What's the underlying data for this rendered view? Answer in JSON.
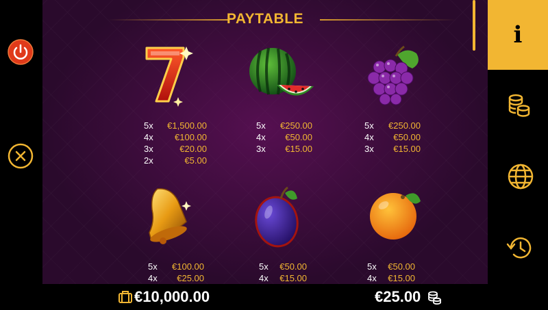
{
  "title": "PAYTABLE",
  "colors": {
    "accent": "#f2b632",
    "background": "#2a0a2c",
    "panel": "#000000"
  },
  "symbols": [
    {
      "name": "seven",
      "pays": [
        {
          "mult": "5x",
          "val": "€1,500.00"
        },
        {
          "mult": "4x",
          "val": "€100.00"
        },
        {
          "mult": "3x",
          "val": "€20.00"
        },
        {
          "mult": "2x",
          "val": "€5.00"
        }
      ]
    },
    {
      "name": "watermelon",
      "pays": [
        {
          "mult": "5x",
          "val": "€250.00"
        },
        {
          "mult": "4x",
          "val": "€50.00"
        },
        {
          "mult": "3x",
          "val": "€15.00"
        }
      ]
    },
    {
      "name": "grapes",
      "pays": [
        {
          "mult": "5x",
          "val": "€250.00"
        },
        {
          "mult": "4x",
          "val": "€50.00"
        },
        {
          "mult": "3x",
          "val": "€15.00"
        }
      ]
    },
    {
      "name": "bell",
      "pays": [
        {
          "mult": "5x",
          "val": "€100.00"
        },
        {
          "mult": "4x",
          "val": "€25.00"
        }
      ]
    },
    {
      "name": "plum",
      "pays": [
        {
          "mult": "5x",
          "val": "€50.00"
        },
        {
          "mult": "4x",
          "val": "€15.00"
        }
      ]
    },
    {
      "name": "orange",
      "pays": [
        {
          "mult": "5x",
          "val": "€50.00"
        },
        {
          "mult": "4x",
          "val": "€15.00"
        }
      ]
    }
  ],
  "footer": {
    "balance": "€10,000.00",
    "bet": "€25.00"
  },
  "icons": {
    "power": "power-icon",
    "close": "close-icon",
    "info": "info-icon",
    "coins": "coins-icon",
    "globe": "globe-icon",
    "history": "history-icon",
    "wallet": "wallet-icon"
  }
}
